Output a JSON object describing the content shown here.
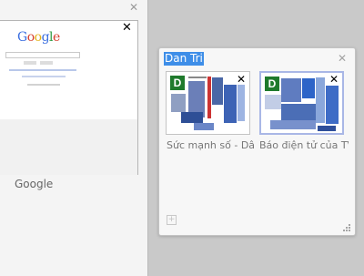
{
  "groups": [
    {
      "title": "Google",
      "tabs": [
        {
          "thumbnail_logo": "Google"
        }
      ]
    },
    {
      "title": "Dan Tri",
      "tabs": [
        {
          "title": "Sức mạnh số - Dân",
          "favicon_letter": "D"
        },
        {
          "title": "Báo điện tử của TV",
          "favicon_letter": "D"
        }
      ]
    }
  ],
  "icons": {
    "close": "✕",
    "new_tab": "+",
    "resize_grip": "resize-grip-icon"
  },
  "colors": {
    "title_highlight": "#3e8ee8",
    "favicon_bg": "#1f7a2c",
    "canvas_bg": "#c9c9c9"
  }
}
